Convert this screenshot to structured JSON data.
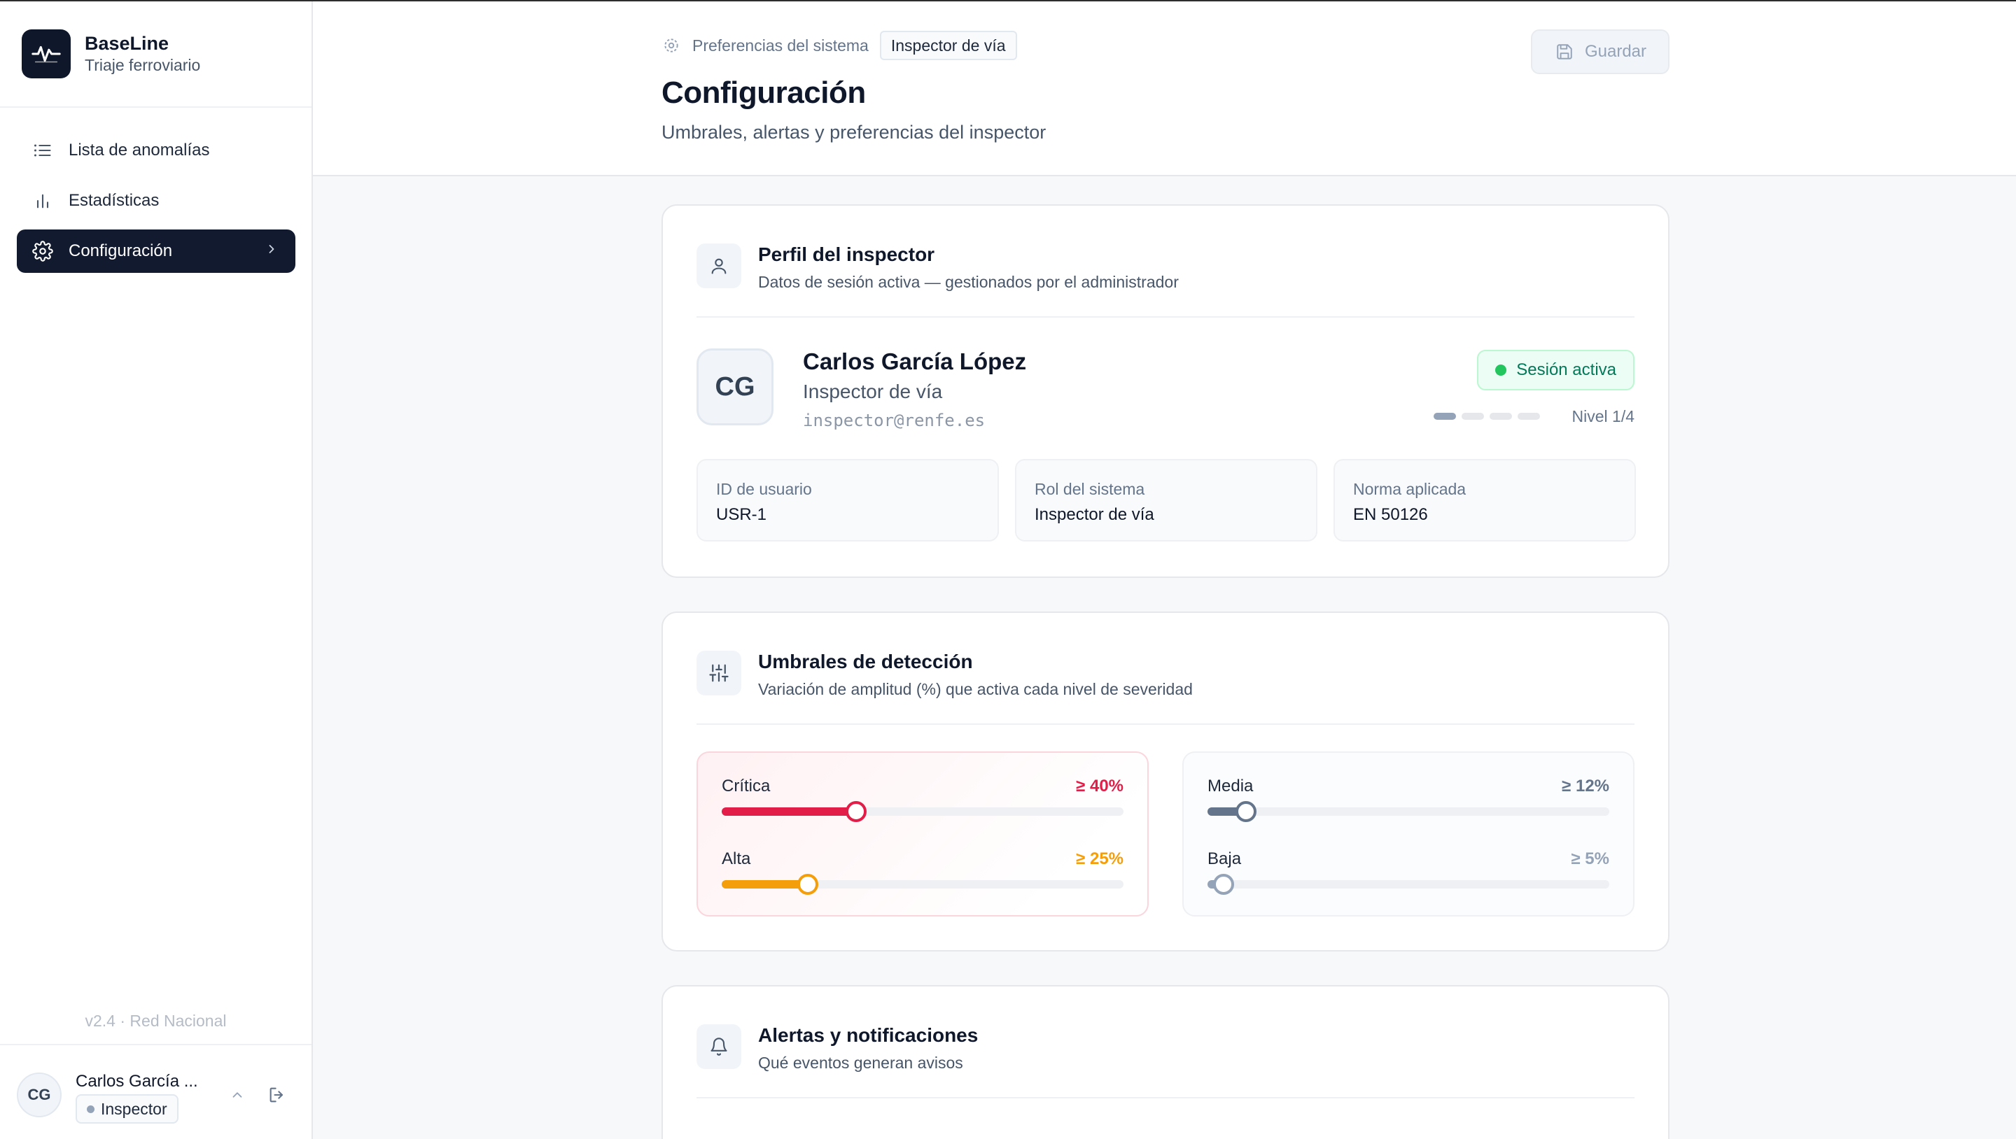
{
  "brand": {
    "name": "BaseLine",
    "subtitle": "Triaje ferroviario"
  },
  "nav": [
    {
      "label": "Lista de anomalías",
      "icon": "list-icon"
    },
    {
      "label": "Estadísticas",
      "icon": "bar-chart-icon"
    },
    {
      "label": "Configuración",
      "icon": "gear-icon",
      "active": true
    }
  ],
  "version": "v2.4 · Red Nacional",
  "current_user": {
    "initials": "CG",
    "name": "Carlos García ...",
    "role": "Inspector"
  },
  "breadcrumb": {
    "parent": "Preferencias del sistema",
    "current": "Inspector de vía"
  },
  "page": {
    "title": "Configuración",
    "subtitle": "Umbrales, alertas y preferencias del inspector"
  },
  "save_label": "Guardar",
  "profile": {
    "title": "Perfil del inspector",
    "subtitle": "Datos de sesión activa — gestionados por el administrador",
    "initials": "CG",
    "name": "Carlos García López",
    "role": "Inspector de vía",
    "email": "inspector@renfe.es",
    "status": "Sesión activa",
    "level": {
      "current": 1,
      "max": 4,
      "label": "Nivel 1/4"
    },
    "fields": [
      {
        "label": "ID de usuario",
        "value": "USR-1"
      },
      {
        "label": "Rol del sistema",
        "value": "Inspector de vía"
      },
      {
        "label": "Norma aplicada",
        "value": "EN 50126"
      }
    ]
  },
  "thresholds": {
    "title": "Umbrales de detección",
    "subtitle": "Variación de amplitud (%) que activa cada nivel de severidad",
    "items": [
      {
        "label": "Crítica",
        "value_label": "≥ 40%",
        "fraction": 0.335,
        "color": "#e11d48"
      },
      {
        "label": "Alta",
        "value_label": "≥ 25%",
        "fraction": 0.215,
        "color": "#f59e0b"
      },
      {
        "label": "Media",
        "value_label": "≥ 12%",
        "fraction": 0.095,
        "color": "#64748b"
      },
      {
        "label": "Baja",
        "value_label": "≥ 5%",
        "fraction": 0.04,
        "color": "#94a3b8"
      }
    ]
  },
  "alerts": {
    "title": "Alertas y notificaciones",
    "subtitle": "Qué eventos generan avisos"
  }
}
